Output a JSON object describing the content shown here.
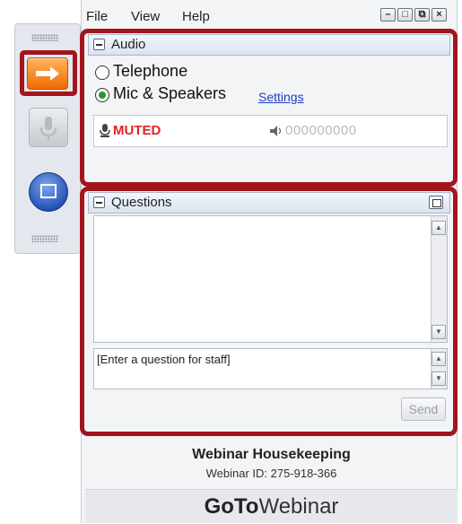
{
  "menu": {
    "file": "File",
    "view": "View",
    "help": "Help"
  },
  "window_controls": {
    "minimize": "–",
    "maximize": "□",
    "restore": "⧉",
    "close": "×"
  },
  "audio": {
    "title": "Audio",
    "options": [
      "Telephone",
      "Mic & Speakers"
    ],
    "selected_option": "Mic & Speakers",
    "settings_link": "Settings",
    "mute_status": "MUTED",
    "level_indicator": "000000000"
  },
  "questions": {
    "title": "Questions",
    "placeholder": "[Enter a question for staff]",
    "send_label": "Send"
  },
  "footer": {
    "title": "Webinar Housekeeping",
    "webinar_id": "Webinar ID: 275-918-366",
    "brand_bold": "GoTo",
    "brand_light": "Webinar"
  },
  "colors": {
    "highlight": "#a2151c",
    "muted": "#e32222",
    "link": "#1a3fc6",
    "selected_radio": "#1f9a2a"
  },
  "icons": [
    "arrow-right-icon",
    "microphone-icon",
    "screen-share-icon",
    "mic-muted-icon",
    "speaker-icon",
    "popout-icon"
  ]
}
